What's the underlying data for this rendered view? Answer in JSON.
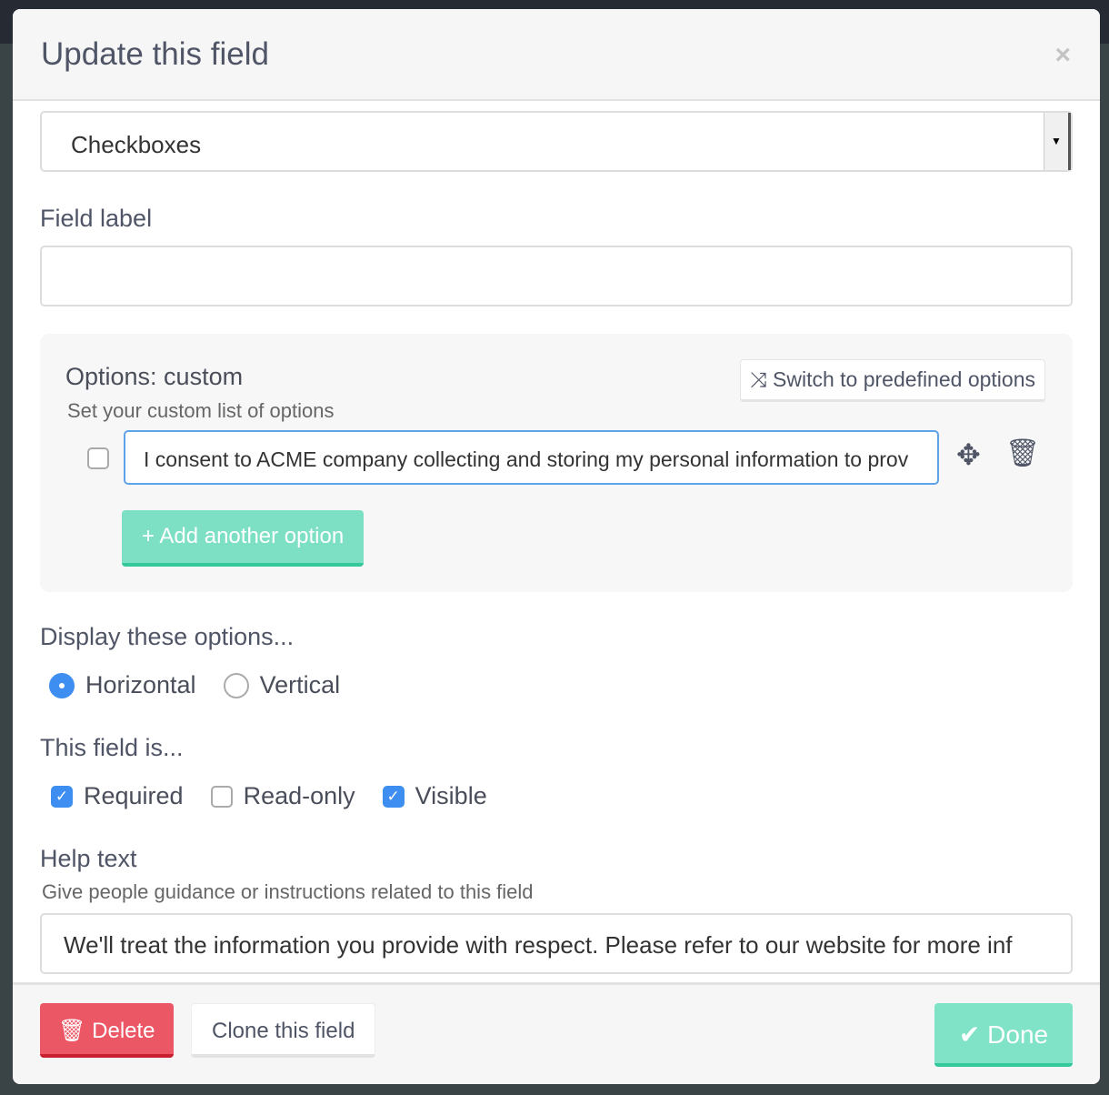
{
  "modal": {
    "title": "Update this field",
    "close_icon": "close-icon"
  },
  "field_type": {
    "selected": "Checkboxes"
  },
  "field_label": {
    "label": "Field label",
    "value": ""
  },
  "options": {
    "title": "Options: custom",
    "subtitle": "Set your custom list of options",
    "switch_label": "Switch to predefined options",
    "items": [
      {
        "checked": false,
        "value": "I consent to ACME company collecting and storing my personal information to prov"
      }
    ],
    "add_label": "+ Add another option"
  },
  "display": {
    "label": "Display these options...",
    "choices": [
      {
        "label": "Horizontal",
        "selected": true
      },
      {
        "label": "Vertical",
        "selected": false
      }
    ]
  },
  "field_is": {
    "label": "This field is...",
    "flags": [
      {
        "label": "Required",
        "checked": true
      },
      {
        "label": "Read-only",
        "checked": false
      },
      {
        "label": "Visible",
        "checked": true
      }
    ]
  },
  "help": {
    "label": "Help text",
    "subtitle": "Give people guidance or instructions related to this field",
    "value": "We'll treat the information you provide with respect. Please refer to our website for more inf"
  },
  "footer": {
    "delete_label": "Delete",
    "clone_label": "Clone this field",
    "done_label": "Done"
  },
  "colors": {
    "primary": "#3d8ef0",
    "success": "#7de0c4",
    "danger": "#ec5766"
  }
}
